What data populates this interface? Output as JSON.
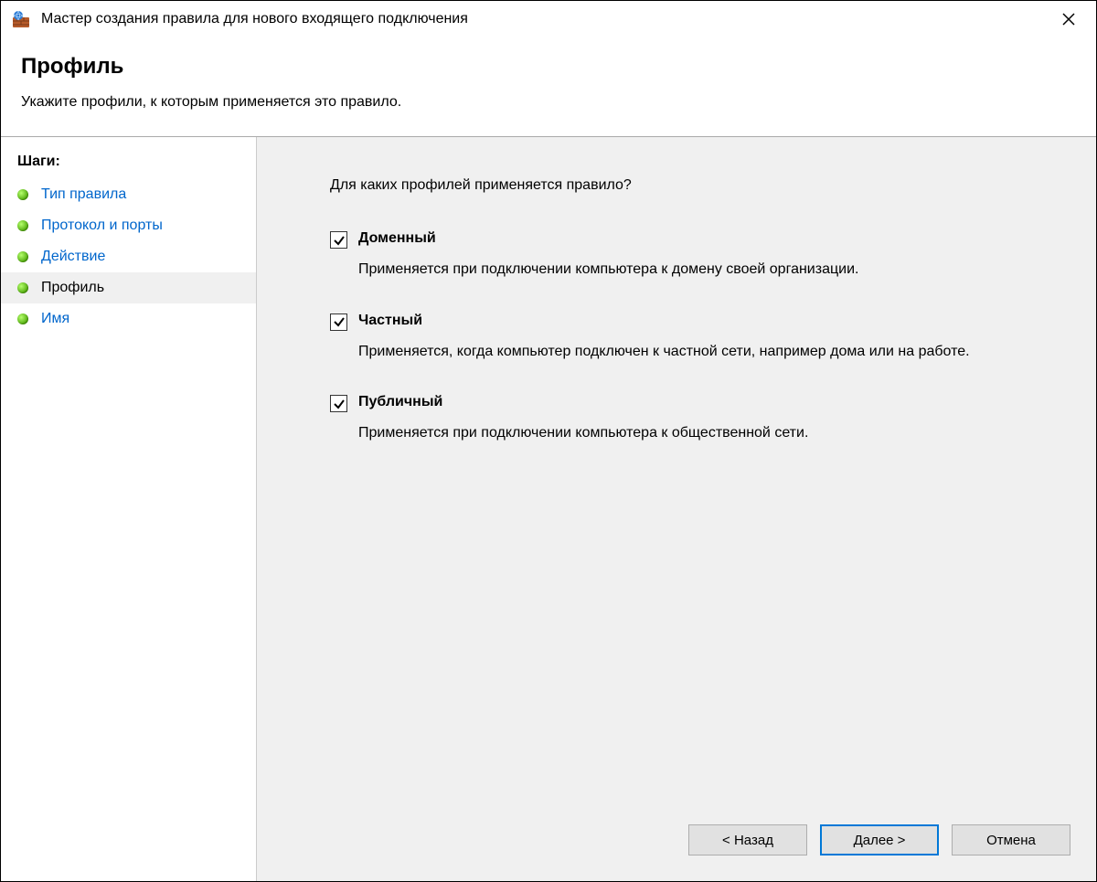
{
  "window": {
    "title": "Мастер создания правила для нового входящего подключения"
  },
  "header": {
    "page_title": "Профиль",
    "subtitle": "Укажите профили, к которым применяется это правило."
  },
  "sidebar": {
    "steps_label": "Шаги:",
    "items": [
      {
        "label": "Тип правила",
        "current": false
      },
      {
        "label": "Протокол и порты",
        "current": false
      },
      {
        "label": "Действие",
        "current": false
      },
      {
        "label": "Профиль",
        "current": true
      },
      {
        "label": "Имя",
        "current": false
      }
    ]
  },
  "content": {
    "question": "Для каких профилей применяется правило?",
    "options": [
      {
        "title": "Доменный",
        "checked": true,
        "description": "Применяется при подключении компьютера к домену своей организации."
      },
      {
        "title": "Частный",
        "checked": true,
        "description": "Применяется, когда компьютер подключен к частной сети, например дома или на работе."
      },
      {
        "title": "Публичный",
        "checked": true,
        "description": "Применяется при подключении компьютера к общественной сети."
      }
    ]
  },
  "buttons": {
    "back": "< Назад",
    "next": "Далее >",
    "cancel": "Отмена"
  }
}
